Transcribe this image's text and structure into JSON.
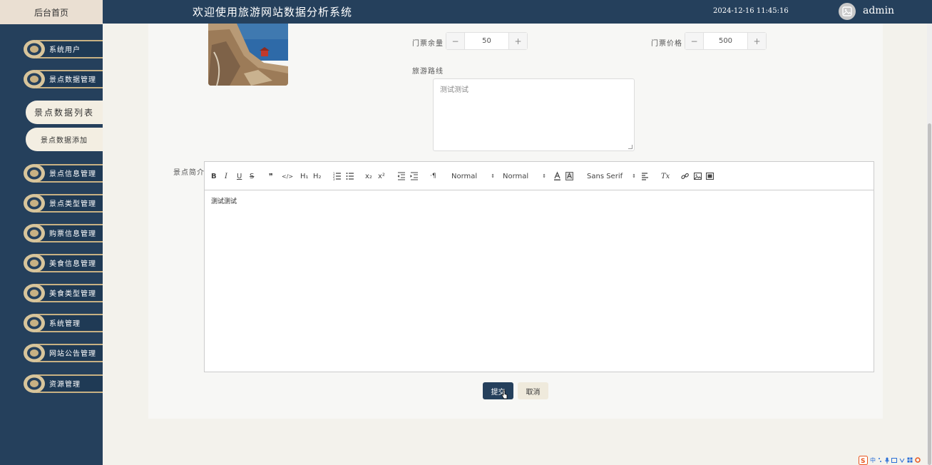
{
  "sidebar": {
    "home_label": "后台首页",
    "items": [
      {
        "label": "系统用户"
      },
      {
        "label": "景点数据管理"
      },
      {
        "label": "景点信息管理"
      },
      {
        "label": "景点类型管理"
      },
      {
        "label": "购票信息管理"
      },
      {
        "label": "美食信息管理"
      },
      {
        "label": "美食类型管理"
      },
      {
        "label": "系统管理"
      },
      {
        "label": "网站公告管理"
      },
      {
        "label": "资源管理"
      }
    ],
    "subitems": [
      {
        "label": "景点数据列表",
        "active": true
      },
      {
        "label": "景点数据添加",
        "active": false
      }
    ]
  },
  "header": {
    "title": "欢迎使用旅游网站数据分析系统",
    "datetime": "2024-12-16 11:45:16",
    "username": "admin"
  },
  "form": {
    "ticket_remaining": {
      "label": "门票余量",
      "value": "50",
      "minus": "−",
      "plus": "+"
    },
    "ticket_price": {
      "label": "门票价格",
      "value": "500",
      "minus": "−",
      "plus": "+"
    },
    "route": {
      "label": "旅游路线",
      "value": "测试测试"
    },
    "intro": {
      "label": "景点简介",
      "content": "测试测试"
    }
  },
  "toolbar": {
    "header_select": "Normal",
    "size_select": "Normal",
    "font_select": "Sans Serif",
    "h1": "H₁",
    "h2": "H₂",
    "sub": "x₂",
    "sup": "x²",
    "quote": "❞",
    "code": "</>",
    "rtl": "·¶",
    "clean": "Tx"
  },
  "buttons": {
    "submit": "提交",
    "cancel": "取消"
  },
  "tray": {
    "ime": "中"
  },
  "colors": {
    "header": "#25405c",
    "accent_gold": "#c8b183",
    "page_bg": "#f3f2ec"
  }
}
